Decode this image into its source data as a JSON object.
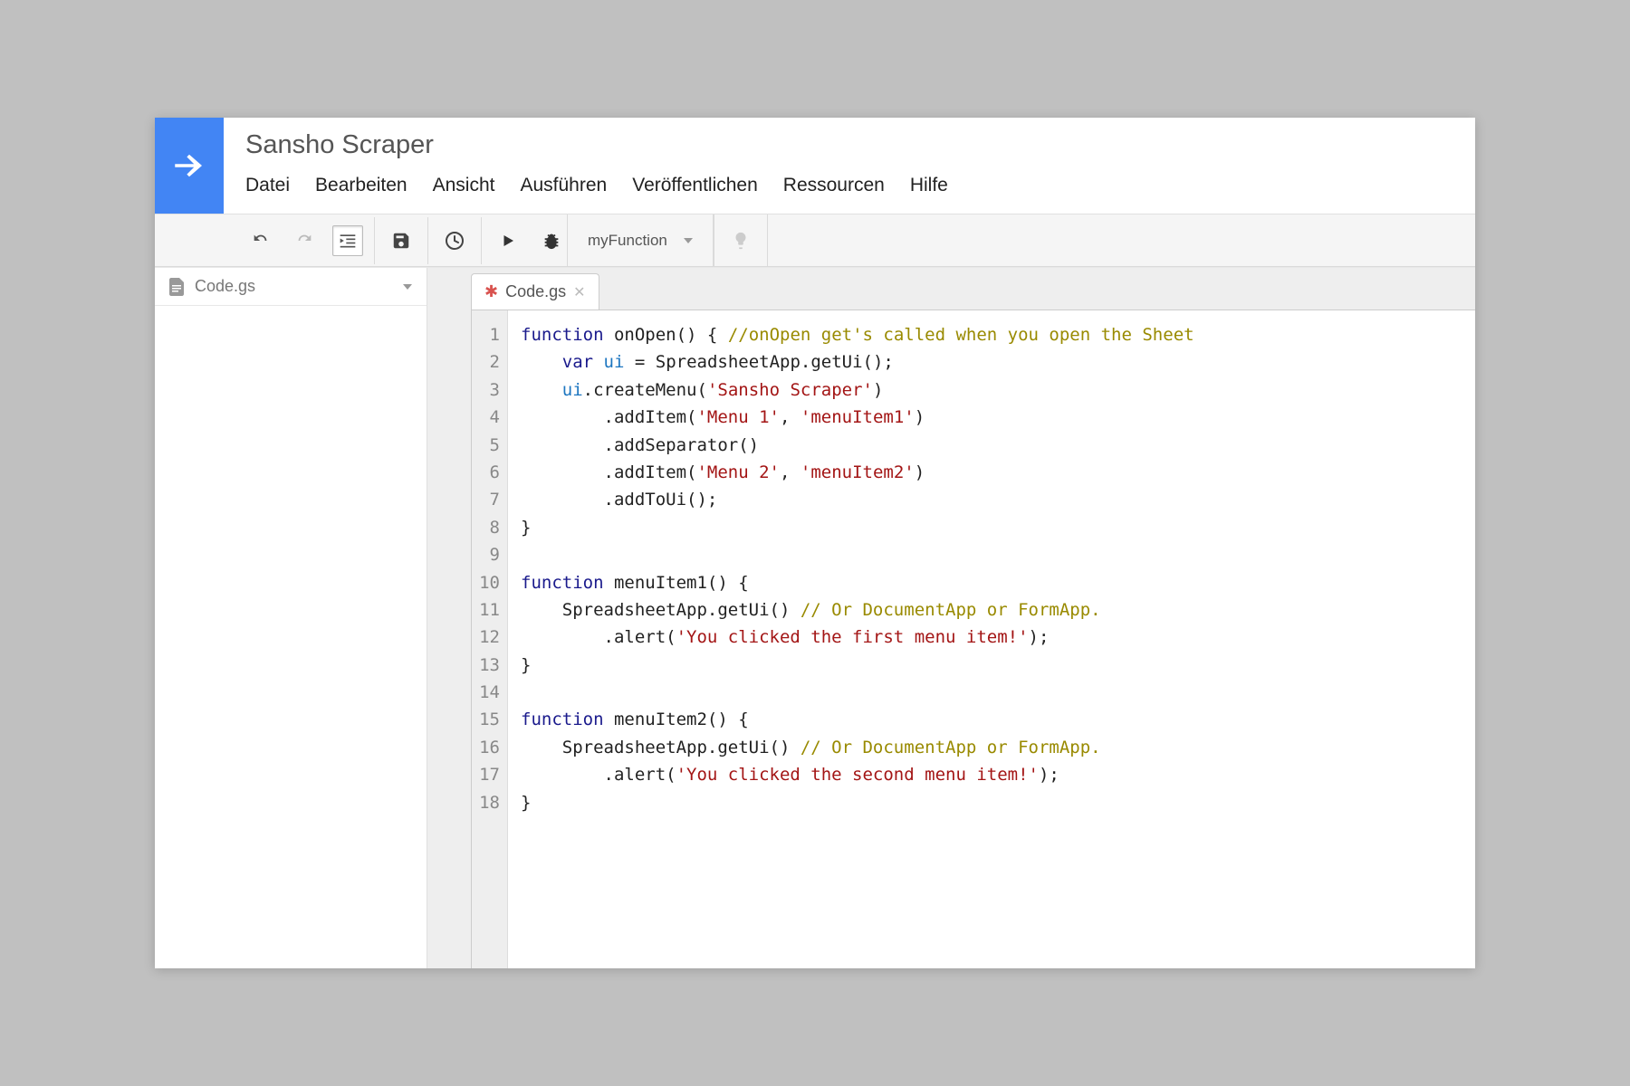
{
  "header": {
    "title": "Sansho Scraper",
    "menu": [
      "Datei",
      "Bearbeiten",
      "Ansicht",
      "Ausführen",
      "Veröffentlichen",
      "Ressourcen",
      "Hilfe"
    ]
  },
  "toolbar": {
    "function_dropdown": "myFunction"
  },
  "sidebar": {
    "file_name": "Code.gs"
  },
  "tab": {
    "modified_label": "Code.gs"
  },
  "editor": {
    "line_numbers": [
      "1",
      "2",
      "3",
      "4",
      "5",
      "6",
      "7",
      "8",
      "9",
      "10",
      "11",
      "12",
      "13",
      "14",
      "15",
      "16",
      "17",
      "18"
    ]
  },
  "code": {
    "l1_kw_function": "function",
    "l1_name_onOpen": "onOpen",
    "l1_paren_brace": "() { ",
    "l1_comment": "//onOpen get's called when you open the Sheet",
    "l2_pre": "    ",
    "l2_kw_var": "var",
    "l2_sp": " ",
    "l2_id_ui": "ui",
    "l2_rest": " = SpreadsheetApp.getUi();",
    "l3_pre": "    ",
    "l3_id_ui": "ui",
    "l3_mid": ".createMenu(",
    "l3_str": "'Sansho Scraper'",
    "l3_end": ")",
    "l4_pre": "        .addItem(",
    "l4_str1": "'Menu 1'",
    "l4_comma": ", ",
    "l4_str2": "'menuItem1'",
    "l4_end": ")",
    "l5": "        .addSeparator()",
    "l6_pre": "        .addItem(",
    "l6_str1": "'Menu 2'",
    "l6_comma": ", ",
    "l6_str2": "'menuItem2'",
    "l6_end": ")",
    "l7": "        .addToUi();",
    "l8": "}",
    "l9": "",
    "l10_kw_function": "function",
    "l10_name": " menuItem1() {",
    "l11_pre": "    SpreadsheetApp.getUi() ",
    "l11_comment": "// Or DocumentApp or FormApp.",
    "l12_pre": "        .alert(",
    "l12_str": "'You clicked the first menu item!'",
    "l12_end": ");",
    "l13": "}",
    "l14": "",
    "l15_kw_function": "function",
    "l15_name": " menuItem2() {",
    "l16_pre": "    SpreadsheetApp.getUi() ",
    "l16_comment": "// Or DocumentApp or FormApp.",
    "l17_pre": "        .alert(",
    "l17_str": "'You clicked the second menu item!'",
    "l17_end": ");",
    "l18": "}"
  }
}
